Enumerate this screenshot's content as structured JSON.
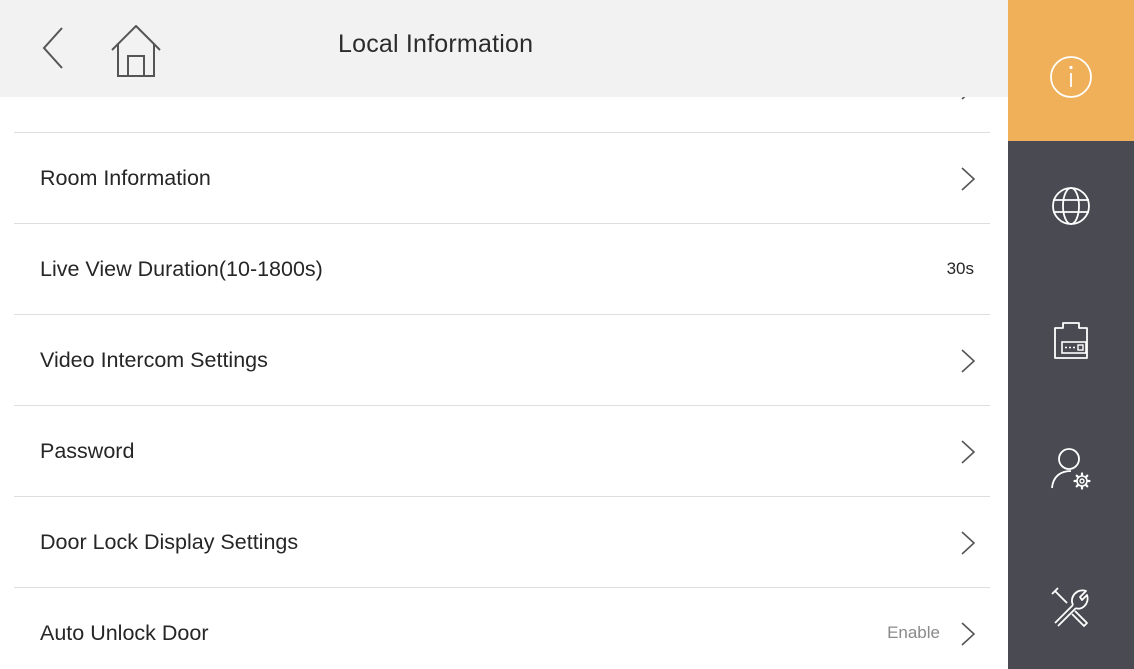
{
  "header": {
    "title": "Local Information",
    "back_icon": "back-chevron-icon",
    "home_icon": "home-icon"
  },
  "list": {
    "rows": [
      {
        "label": "Room Information",
        "value": "",
        "has_chevron": true
      },
      {
        "label": "Live View Duration(10-1800s)",
        "value": "30s",
        "has_chevron": false
      },
      {
        "label": "Video Intercom Settings",
        "value": "",
        "has_chevron": true
      },
      {
        "label": "Password",
        "value": "",
        "has_chevron": true
      },
      {
        "label": "Door Lock Display Settings",
        "value": "",
        "has_chevron": true
      },
      {
        "label": "Auto Unlock Door",
        "value": "Enable",
        "has_chevron": true
      }
    ]
  },
  "sidebar": {
    "items": [
      {
        "icon": "info-icon",
        "active": true
      },
      {
        "icon": "globe-icon",
        "active": false
      },
      {
        "icon": "device-icon",
        "active": false
      },
      {
        "icon": "user-settings-icon",
        "active": false
      },
      {
        "icon": "tools-icon",
        "active": false
      }
    ]
  },
  "colors": {
    "accent": "#f0b05a",
    "sidebar_bg": "#4a4a53",
    "header_bg": "#f2f2f2",
    "divider": "#dedede",
    "text": "#262626",
    "secondary_text": "#8a8a8a"
  }
}
